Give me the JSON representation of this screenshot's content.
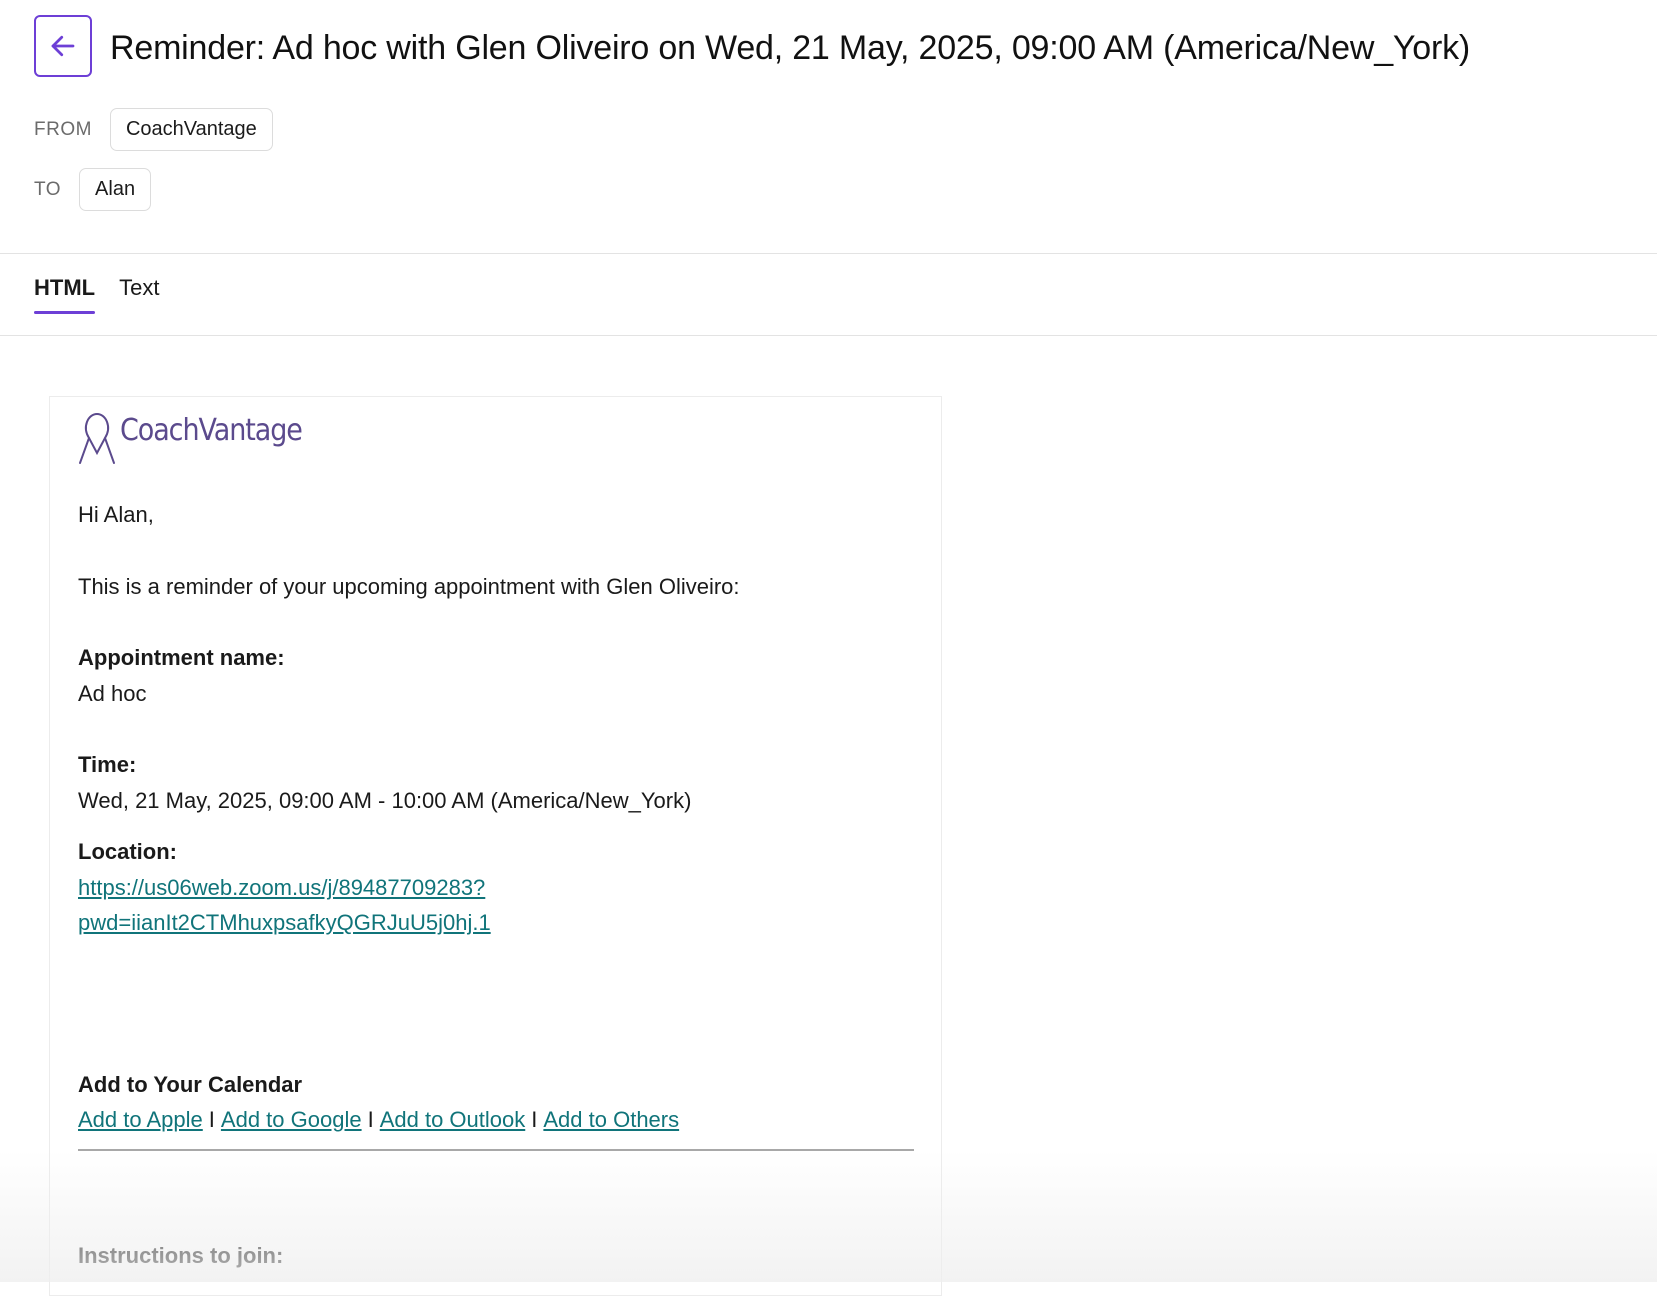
{
  "header": {
    "subject": "Reminder: Ad hoc with Glen Oliveiro on Wed, 21 May, 2025, 09:00 AM (America/New_York)",
    "back_icon": "arrow-left-icon",
    "from_label": "FROM",
    "from_value": "CoachVantage",
    "to_label": "TO",
    "to_value": "Alan"
  },
  "tabs": [
    {
      "label": "HTML",
      "active": true
    },
    {
      "label": "Text",
      "active": false
    }
  ],
  "email": {
    "logo_text": "CoachVantage",
    "greeting": "Hi Alan,",
    "intro": "This is a reminder of your upcoming appointment with Glen Oliveiro:",
    "appointment_label": "Appointment name:",
    "appointment_value": "Ad hoc",
    "time_label": "Time:",
    "time_value": "Wed, 21 May, 2025, 09:00 AM - 10:00 AM (America/New_York)",
    "location_label": "Location:",
    "location_line1": "https://us06web.zoom.us/j/89487709283?",
    "location_line2": "pwd=iianIt2CTMhuxpsafkyQGRJuU5j0hj.1",
    "calendar_heading": "Add to Your Calendar",
    "calendar_links": [
      "Add to Apple",
      "Add to Google",
      "Add to Outlook",
      "Add to Others"
    ],
    "separator": "I",
    "instructions_label": "Instructions to join:"
  },
  "colors": {
    "accent": "#6d3fd6",
    "link": "#10747a",
    "logo": "#5b4a8d"
  }
}
